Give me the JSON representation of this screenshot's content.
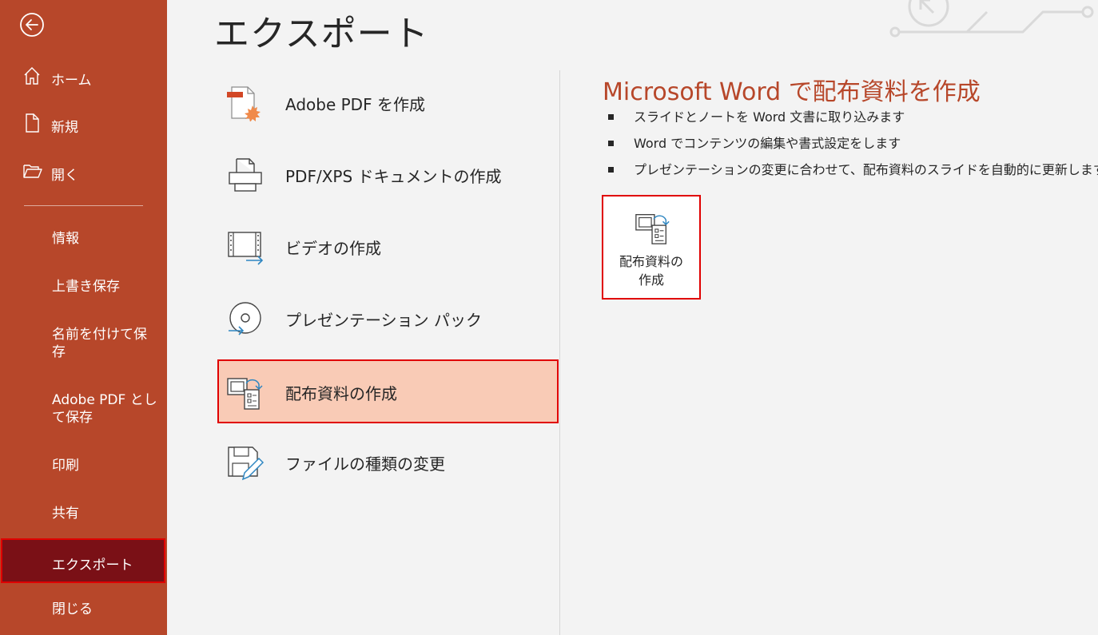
{
  "sidebar": {
    "back_icon": "back-arrow-icon",
    "home": {
      "label": "ホーム",
      "icon": "home-icon"
    },
    "new": {
      "label": "新規",
      "icon": "new-document-icon"
    },
    "open": {
      "label": "開く",
      "icon": "open-folder-icon"
    },
    "items": [
      {
        "label": "情報"
      },
      {
        "label": "上書き保存"
      },
      {
        "label": "名前を付けて保存"
      },
      {
        "label": "Adobe PDF として保存"
      },
      {
        "label": "印刷"
      },
      {
        "label": "共有"
      },
      {
        "label": "エクスポート",
        "active": true
      },
      {
        "label": "閉じる"
      }
    ]
  },
  "page": {
    "title": "エクスポート"
  },
  "options": [
    {
      "label": "Adobe PDF を作成",
      "icon": "adobe-pdf-icon"
    },
    {
      "label": "PDF/XPS ドキュメントの作成",
      "icon": "pdf-xps-icon"
    },
    {
      "label": "ビデオの作成",
      "icon": "video-icon"
    },
    {
      "label": "プレゼンテーション パック",
      "icon": "package-cd-icon"
    },
    {
      "label": "配布資料の作成",
      "icon": "handouts-icon",
      "selected": true
    },
    {
      "label": "ファイルの種類の変更",
      "icon": "change-file-type-icon"
    }
  ],
  "detail": {
    "title": "Microsoft Word で配布資料を作成",
    "bullets": [
      "スライドとノートを Word 文書に取り込みます",
      "Word でコンテンツの編集や書式設定をします",
      "プレゼンテーションの変更に合わせて、配布資料のスライドを自動的に更新します"
    ],
    "button": {
      "line1": "配布資料の",
      "line2": "作成",
      "icon": "handouts-icon"
    }
  },
  "colors": {
    "accent": "#b7472a",
    "active_nav": "#7a1016",
    "highlight": "#f9cbb6",
    "outline": "#e00000"
  }
}
